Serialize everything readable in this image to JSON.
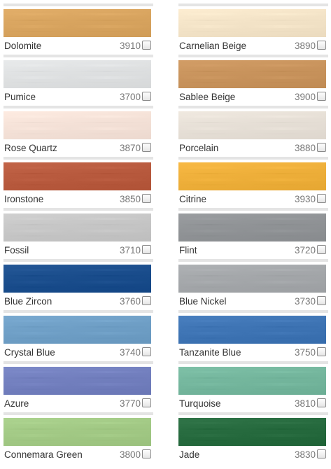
{
  "swatches": [
    {
      "name": "Dolomite",
      "code": "3910",
      "color": "#d8a45f",
      "checked": false
    },
    {
      "name": "Carnelian Beige",
      "code": "3890",
      "color": "#f3e3c7",
      "checked": false
    },
    {
      "name": "Pumice",
      "code": "3700",
      "color": "#dee0e1",
      "checked": false
    },
    {
      "name": "Sablee Beige",
      "code": "3900",
      "color": "#c8935c",
      "checked": false
    },
    {
      "name": "Rose Quartz",
      "code": "3870",
      "color": "#f4e1d7",
      "checked": false
    },
    {
      "name": "Porcelain",
      "code": "3880",
      "color": "#e6dfd6",
      "checked": false
    },
    {
      "name": "Ironstone",
      "code": "3850",
      "color": "#b85a3e",
      "checked": false
    },
    {
      "name": "Citrine",
      "code": "3930",
      "color": "#eeaf3a",
      "checked": false
    },
    {
      "name": "Fossil",
      "code": "3710",
      "color": "#c6c6c6",
      "checked": false
    },
    {
      "name": "Flint",
      "code": "3720",
      "color": "#909396",
      "checked": false
    },
    {
      "name": "Blue Zircon",
      "code": "3760",
      "color": "#1a4d8c",
      "checked": false
    },
    {
      "name": "Blue Nickel",
      "code": "3730",
      "color": "#a4a7aa",
      "checked": false
    },
    {
      "name": "Crystal Blue",
      "code": "3740",
      "color": "#6f9fc6",
      "checked": false
    },
    {
      "name": "Tanzanite Blue",
      "code": "3750",
      "color": "#3e74b4",
      "checked": false
    },
    {
      "name": "Azure",
      "code": "3770",
      "color": "#727fbe",
      "checked": false
    },
    {
      "name": "Turquoise",
      "code": "3810",
      "color": "#74b69d",
      "checked": false
    },
    {
      "name": "Connemara Green",
      "code": "3800",
      "color": "#a2c985",
      "checked": false
    },
    {
      "name": "Jade",
      "code": "3830",
      "color": "#266a3e",
      "checked": false
    }
  ]
}
